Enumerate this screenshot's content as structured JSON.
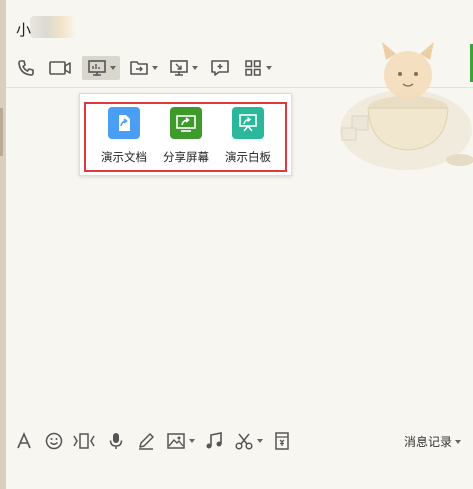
{
  "chat": {
    "title_visible": "小"
  },
  "toolbar": {
    "items": [
      {
        "name": "phone-icon"
      },
      {
        "name": "video-call-icon"
      },
      {
        "name": "remote-demo-icon",
        "dropdown": true,
        "active": true
      },
      {
        "name": "send-file-icon",
        "dropdown": true
      },
      {
        "name": "remote-desktop-icon",
        "dropdown": true
      },
      {
        "name": "group-invite-icon"
      },
      {
        "name": "apps-grid-icon",
        "dropdown": true
      }
    ]
  },
  "popup": {
    "items": [
      {
        "label": "演示文档",
        "icon": "present-document-icon",
        "color": "#4a9ff5"
      },
      {
        "label": "分享屏幕",
        "icon": "share-screen-icon",
        "color": "#3f9a2c"
      },
      {
        "label": "演示白板",
        "icon": "present-whiteboard-icon",
        "color": "#2bb79a"
      }
    ],
    "highlight_color": "#e0383b"
  },
  "bottom_toolbar": {
    "items": [
      {
        "name": "font-icon"
      },
      {
        "name": "emoji-icon"
      },
      {
        "name": "shake-icon"
      },
      {
        "name": "voice-icon"
      },
      {
        "name": "pen-icon"
      },
      {
        "name": "image-icon",
        "dropdown": true
      },
      {
        "name": "music-icon"
      },
      {
        "name": "scissors-icon",
        "dropdown": true
      },
      {
        "name": "red-packet-icon"
      }
    ],
    "history_label": "消息记录"
  }
}
